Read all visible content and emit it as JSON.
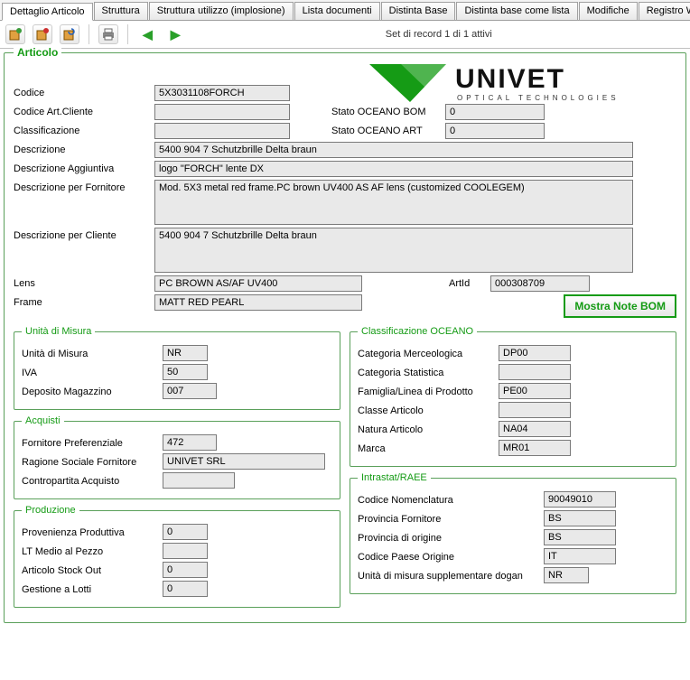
{
  "tabs": [
    "Dettaglio Articolo",
    "Struttura",
    "Struttura utilizzo (implosione)",
    "Lista documenti",
    "Distinta Base",
    "Distinta base come lista",
    "Modifiche",
    "Registro Workflow"
  ],
  "activeTab": 0,
  "toolbar": {
    "recordStatus": "Set di record 1 di 1 attivi"
  },
  "main": {
    "legend": "Articolo",
    "logoText": "UNIVET",
    "logoSub": "OPTICAL  TECHNOLOGIES",
    "noteBomBtn": "Mostra Note BOM",
    "labels": {
      "codice": "Codice",
      "codiceArtCliente": "Codice Art.Cliente",
      "classificazione": "Classificazione",
      "descrizione": "Descrizione",
      "descrAgg": "Descrizione Aggiuntiva",
      "descrFornitore": "Descrizione per Fornitore",
      "descrCliente": "Descrizione per Cliente",
      "lens": "Lens",
      "frame": "Frame",
      "artId": "ArtId",
      "statoBom": "Stato OCEANO BOM",
      "statoArt": "Stato OCEANO ART"
    },
    "values": {
      "codice": "5X3031108FORCH",
      "codiceArtCliente": "",
      "classificazione": "",
      "statoBom": "0",
      "statoArt": "0",
      "descrizione": "5400 904 7 Schutzbrille Delta braun",
      "descrAgg": "logo \"FORCH\" lente DX",
      "descrFornitore": "Mod. 5X3 metal red frame.PC brown UV400 AS AF lens (customized COOLEGEM)",
      "descrCliente": "5400 904 7 Schutzbrille Delta braun",
      "lens": "PC BROWN AS/AF UV400",
      "frame": "MATT RED PEARL",
      "artId": "000308709"
    }
  },
  "unitaMisura": {
    "legend": "Unità di Misura",
    "labels": {
      "um": "Unità di Misura",
      "iva": "IVA",
      "dep": "Deposito Magazzino"
    },
    "values": {
      "um": "NR",
      "iva": "50",
      "dep": "007"
    }
  },
  "classOceano": {
    "legend": "Classificazione OCEANO",
    "labels": {
      "catMerc": "Categoria Merceologica",
      "catStat": "Categoria Statistica",
      "fam": "Famiglia/Linea di Prodotto",
      "classe": "Classe Articolo",
      "natura": "Natura Articolo",
      "marca": "Marca"
    },
    "values": {
      "catMerc": "DP00",
      "catStat": "",
      "fam": "PE00",
      "classe": "",
      "natura": "NA04",
      "marca": "MR01"
    }
  },
  "acquisti": {
    "legend": "Acquisti",
    "labels": {
      "forn": "Fornitore Preferenziale",
      "ragSoc": "Ragione Sociale Fornitore",
      "contro": "Contropartita Acquisto"
    },
    "values": {
      "forn": "472",
      "ragSoc": "UNIVET SRL",
      "contro": ""
    }
  },
  "produzione": {
    "legend": "Produzione",
    "labels": {
      "prov": "Provenienza Produttiva",
      "lt": "LT Medio al Pezzo",
      "stock": "Articolo Stock Out",
      "lotti": "Gestione a Lotti"
    },
    "values": {
      "prov": "0",
      "lt": "",
      "stock": "0",
      "lotti": "0"
    }
  },
  "intrastat": {
    "legend": "Intrastat/RAEE",
    "labels": {
      "codNom": "Codice Nomenclatura",
      "provForn": "Provincia Fornitore",
      "provOrig": "Provincia di origine",
      "paese": "Codice Paese Origine",
      "umSup": "Unità di misura supplementare dogan"
    },
    "values": {
      "codNom": "90049010",
      "provForn": "BS",
      "provOrig": "BS",
      "paese": "IT",
      "umSup": "NR"
    }
  }
}
